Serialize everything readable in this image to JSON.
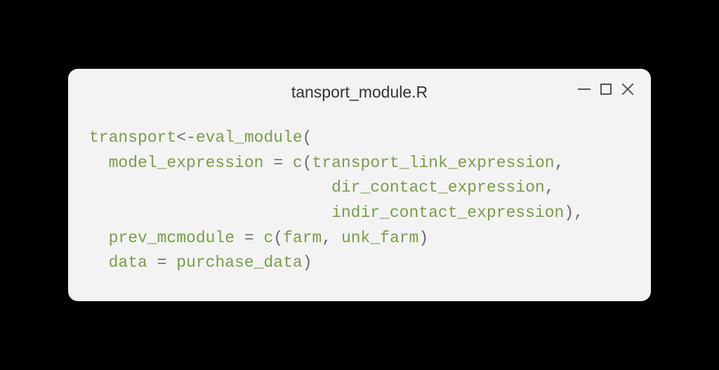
{
  "window": {
    "title": "tansport_module.R"
  },
  "code": {
    "l1": {
      "t1": "transport",
      "t2": "<-",
      "t3": "eval_module",
      "t4": "("
    },
    "l2": {
      "t1": "  model_expression",
      "t2": " ",
      "t3": "=",
      "t4": " ",
      "t5": "c",
      "t6": "(",
      "t7": "transport_link_expression",
      "t8": ","
    },
    "l3": {
      "t1": "                         ",
      "t2": "dir_contact_expression",
      "t3": ","
    },
    "l4": {
      "t1": "                         ",
      "t2": "indir_contact_expression",
      "t3": "),"
    },
    "l5": {
      "t1": "  prev_mcmodule",
      "t2": " ",
      "t3": "=",
      "t4": " ",
      "t5": "c",
      "t6": "(",
      "t7": "farm",
      "t8": ", ",
      "t9": "unk_farm",
      "t10": ")"
    },
    "l6": {
      "t1": "  data",
      "t2": " ",
      "t3": "=",
      "t4": " ",
      "t5": "purchase_data",
      "t6": ")"
    }
  }
}
